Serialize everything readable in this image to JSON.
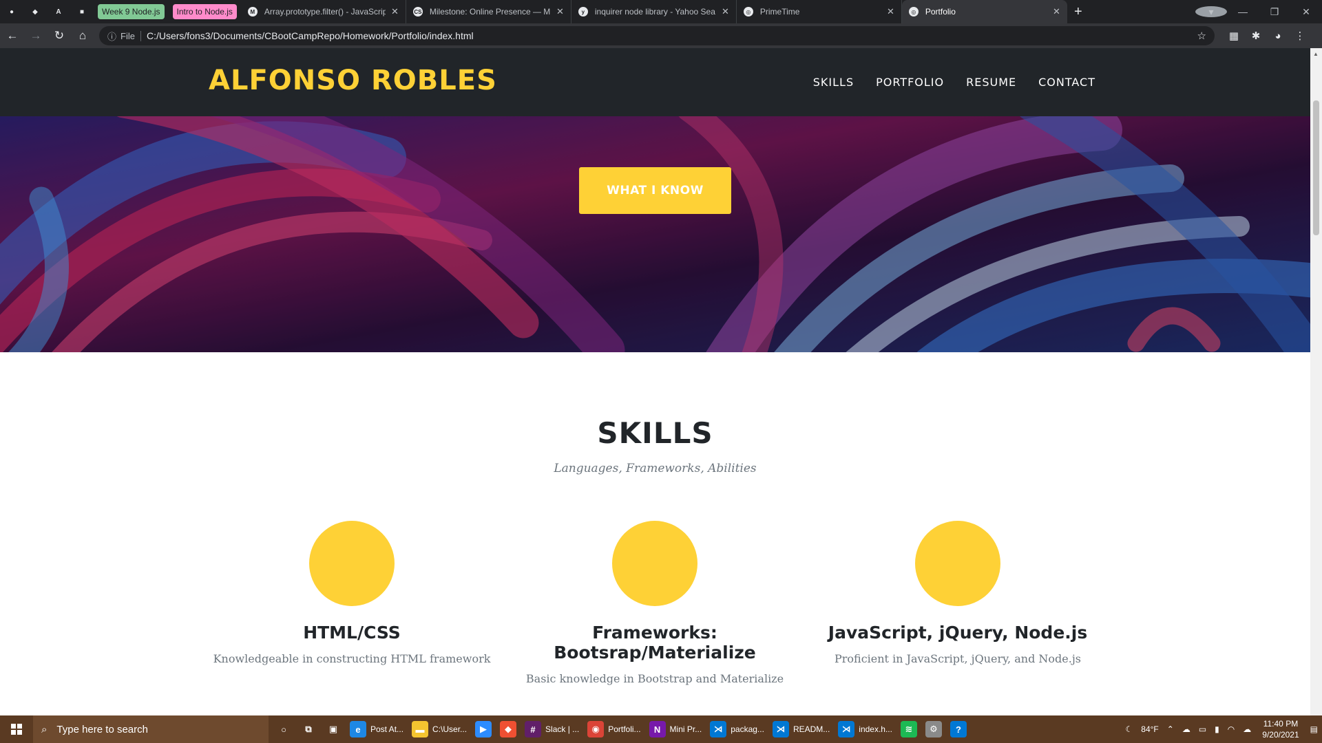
{
  "browser": {
    "pinned_tabs": [
      {
        "icon": "github-icon",
        "glyph": "●"
      },
      {
        "icon": "gitlab-icon",
        "glyph": "◆"
      },
      {
        "icon": "nodeschool-icon",
        "glyph": "A"
      },
      {
        "icon": "book-icon",
        "glyph": "■"
      }
    ],
    "tab_groups": [
      {
        "label": "Week 9 Node.js",
        "color": "#81c995"
      },
      {
        "label": "Intro to Node.js",
        "color": "#ff8bcb"
      }
    ],
    "tabs": [
      {
        "title": "Array.prototype.filter() - JavaScrip",
        "icon": "mdn-icon",
        "glyph": "M",
        "active": false
      },
      {
        "title": "Milestone: Online Presence — M",
        "icon": "codesignal-icon",
        "glyph": "CS",
        "active": false
      },
      {
        "title": "inquirer node library - Yahoo Sea",
        "icon": "yahoo-icon",
        "glyph": "y",
        "active": false
      },
      {
        "title": "PrimeTime",
        "icon": "globe-icon",
        "glyph": "◎",
        "active": false
      },
      {
        "title": "Portfolio",
        "icon": "globe-icon",
        "glyph": "◎",
        "active": true
      }
    ],
    "address": {
      "scheme_label": "File",
      "url": "C:/Users/fons3/Documents/CBootCampRepo/Homework/Portfolio/index.html"
    }
  },
  "site": {
    "brand": "ALFONSO ROBLES",
    "nav": [
      "SKILLS",
      "PORTFOLIO",
      "RESUME",
      "CONTACT"
    ],
    "hero_button": "WHAT I KNOW",
    "skills": {
      "title": "SKILLS",
      "subtitle": "Languages, Frameworks, Abilities",
      "items": [
        {
          "title": "HTML/CSS",
          "description": "Knowledgeable in constructing HTML framework"
        },
        {
          "title": "Frameworks: Bootsrap/Materialize",
          "description": "Basic knowledge in Bootstrap and Materialize"
        },
        {
          "title": "JavaScript, jQuery, Node.js",
          "description": "Proficient in JavaScript, jQuery, and Node.js"
        }
      ]
    },
    "colors": {
      "accent": "#fed136",
      "nav_bg": "#212529"
    }
  },
  "taskbar": {
    "search_placeholder": "Type here to search",
    "apps": [
      {
        "label": "",
        "icon": "cortana-icon",
        "glyph": "○",
        "color": "transparent"
      },
      {
        "label": "",
        "icon": "task-view-icon",
        "glyph": "⧉",
        "color": "transparent"
      },
      {
        "label": "",
        "icon": "store-icon",
        "glyph": "▣",
        "color": "transparent"
      },
      {
        "label": "Post At...",
        "icon": "edge-icon",
        "glyph": "e",
        "color": "#1e88e5"
      },
      {
        "label": "C:\\User...",
        "icon": "folder-icon",
        "glyph": "▬",
        "color": "#f4c430"
      },
      {
        "label": "",
        "icon": "zoom-icon",
        "glyph": "▶",
        "color": "#2d8cff"
      },
      {
        "label": "",
        "icon": "git-icon",
        "glyph": "◆",
        "color": "#f05032"
      },
      {
        "label": "Slack | ...",
        "icon": "slack-icon",
        "glyph": "#",
        "color": "#611f69"
      },
      {
        "label": "Portfoli...",
        "icon": "chrome-icon",
        "glyph": "◉",
        "color": "#db4437"
      },
      {
        "label": "Mini Pr...",
        "icon": "onenote-icon",
        "glyph": "N",
        "color": "#7719aa"
      },
      {
        "label": "packag...",
        "icon": "vscode-icon",
        "glyph": "⋊",
        "color": "#0078d4"
      },
      {
        "label": "READM...",
        "icon": "vscode-icon",
        "glyph": "⋊",
        "color": "#0078d4"
      },
      {
        "label": "index.h...",
        "icon": "vscode-icon",
        "glyph": "⋊",
        "color": "#0078d4"
      },
      {
        "label": "",
        "icon": "spotify-icon",
        "glyph": "≋",
        "color": "#1db954"
      },
      {
        "label": "",
        "icon": "settings-app-icon",
        "glyph": "⚙",
        "color": "#8a8a8a"
      },
      {
        "label": "",
        "icon": "help-icon",
        "glyph": "?",
        "color": "#0078d4"
      }
    ],
    "weather": "84°F",
    "time": "11:40 PM",
    "date": "9/20/2021"
  }
}
